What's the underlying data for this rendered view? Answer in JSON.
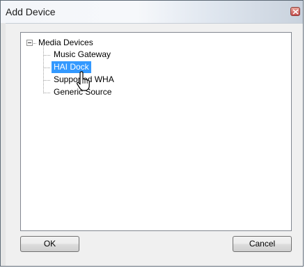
{
  "window": {
    "title": "Add Device"
  },
  "tree": {
    "root_label": "Media Devices",
    "items": [
      {
        "label": "Music Gateway",
        "selected": false
      },
      {
        "label": "HAI Dock",
        "selected": true
      },
      {
        "label": "Supported WHA",
        "selected": false
      },
      {
        "label": "Generic Source",
        "selected": false
      }
    ]
  },
  "buttons": {
    "ok_label": "OK",
    "cancel_label": "Cancel"
  },
  "colors": {
    "selection": "#3399ff",
    "dialog_bg": "#f0f0f0"
  }
}
